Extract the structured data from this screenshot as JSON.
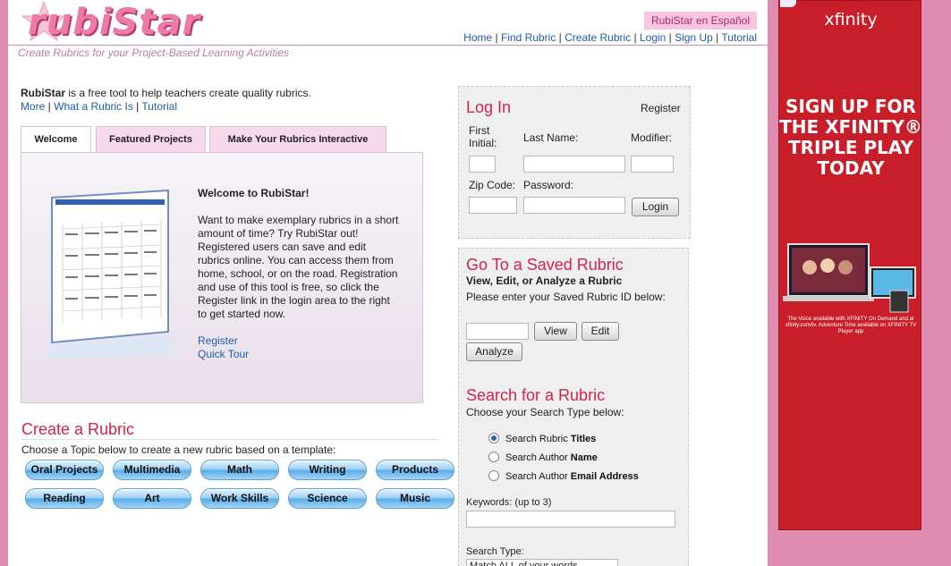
{
  "header": {
    "logo_text": "rubiStar",
    "tagline": "Create Rubrics for your Project-Based Learning Activities",
    "espanol_label": "RubiStar en Español",
    "nav": [
      "Home",
      "Find Rubric",
      "Create Rubric",
      "Login",
      "Sign Up",
      "Tutorial"
    ]
  },
  "intro": {
    "brand": "RubiStar",
    "text": " is a free tool to help teachers create quality rubrics.",
    "links": [
      "More",
      "What a Rubric Is",
      "Tutorial"
    ]
  },
  "tabs": [
    "Welcome",
    "Featured Projects",
    "Make Your Rubrics Interactive"
  ],
  "welcome": {
    "title": "Welcome to RubiStar!",
    "body": "Want to make exemplary rubrics in a short amount of time? Try RubiStar out! Registered users can save and edit rubrics online. You can access them from home, school, or on the road. Registration and use of this tool is free, so click the Register link in the login area to the right to get started now.",
    "register": "Register",
    "quick_tour": "Quick Tour"
  },
  "create": {
    "title": "Create a Rubric",
    "subtitle": "Choose a Topic below to create a new rubric based on a template:",
    "topics": [
      "Oral Projects",
      "Multimedia",
      "Math",
      "Writing",
      "Products",
      "Reading",
      "Art",
      "Work Skills",
      "Science",
      "Music"
    ]
  },
  "login": {
    "title": "Log In",
    "register": "Register",
    "first_initial": "First Initial:",
    "last_name": "Last Name:",
    "modifier": "Modifier:",
    "zip_code": "Zip Code:",
    "password": "Password:",
    "login_button": "Login"
  },
  "saved": {
    "title": "Go To a Saved Rubric",
    "subtitle": "View, Edit, or Analyze a Rubric",
    "prompt": "Please enter your Saved Rubric ID below:",
    "view": "View",
    "edit": "Edit",
    "analyze": "Analyze"
  },
  "search": {
    "title": "Search for a Rubric",
    "prompt": "Choose your Search Type below:",
    "options": [
      {
        "pre": "Search Rubric ",
        "bold": "Titles",
        "selected": true
      },
      {
        "pre": "Search Author ",
        "bold": "Name",
        "selected": false
      },
      {
        "pre": "Search Author ",
        "bold": "Email Address",
        "selected": false
      }
    ],
    "keywords_label": "Keywords: (up to 3)",
    "search_type_label": "Search Type:",
    "search_type_value": "Match ALL of your words"
  },
  "ad": {
    "brand": "xfinity",
    "headline": "SIGN UP FOR THE XFINITY® TRIPLE PLAY TODAY",
    "fine_print": "The Voice available with XFINITY On Demand and at xfinity.com/tv. Adventure Time available on XFINITY TV Player app"
  }
}
